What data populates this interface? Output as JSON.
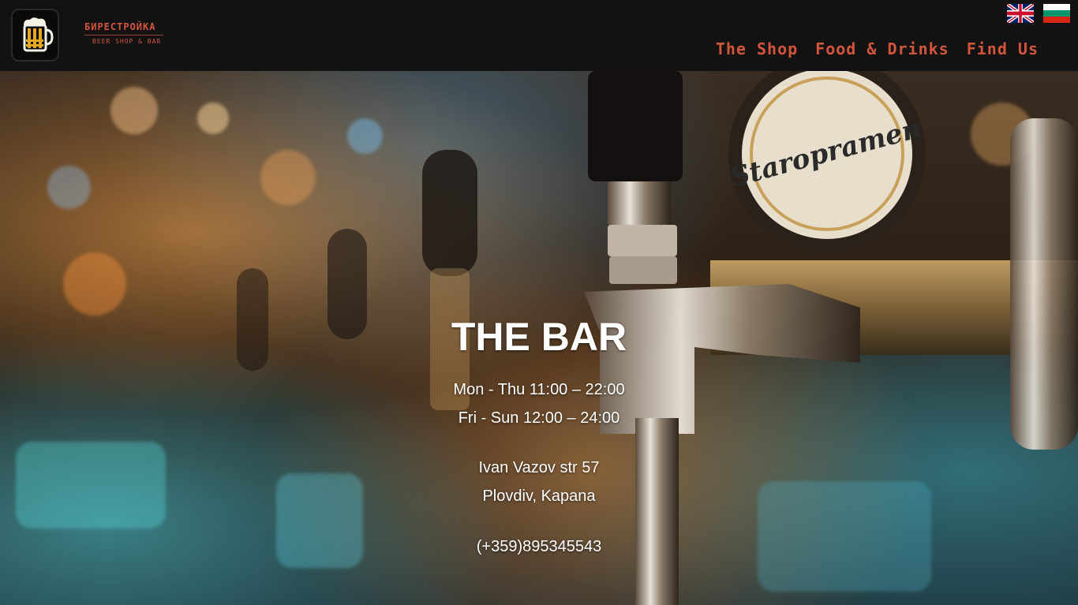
{
  "brand": {
    "name": "БИРЕСТРОЙКА",
    "subtitle": "BEER SHOP & BAR"
  },
  "languages": [
    {
      "code": "en",
      "icon": "uk-flag-icon"
    },
    {
      "code": "bg",
      "icon": "bulgaria-flag-icon"
    }
  ],
  "nav": {
    "items": [
      {
        "label": "The Shop"
      },
      {
        "label": "Food & Drinks"
      },
      {
        "label": "Find Us"
      }
    ]
  },
  "hero": {
    "title": "THE BAR",
    "hours_weekday": "Mon - Thu 11:00 – 22:00",
    "hours_weekend": "Fri - Sun 12:00 – 24:00",
    "address_line1": "Ivan Vazov str 57",
    "address_line2": "Plovdiv, Kapana",
    "phone": "(+359)895345543"
  },
  "colors": {
    "accent": "#d2553c",
    "header_bg": "#121212"
  }
}
